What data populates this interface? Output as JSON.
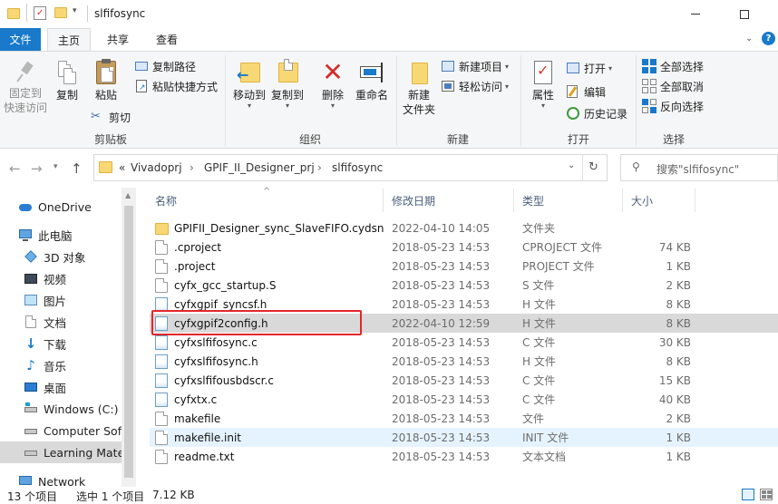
{
  "window": {
    "title": "slfifosync"
  },
  "ribbon_tabs": [
    {
      "label": "文件"
    },
    {
      "label": "主页"
    },
    {
      "label": "共享"
    },
    {
      "label": "查看"
    }
  ],
  "ribbon": {
    "clipboard": {
      "label": "剪贴板",
      "pin": "固定到快速访问",
      "pin_line1": "固定到",
      "pin_line2": "快速访问",
      "copy": "复制",
      "paste": "粘贴",
      "copy_path": "复制路径",
      "paste_shortcut": "粘贴快捷方式",
      "cut": "剪切"
    },
    "organize": {
      "label": "组织",
      "move_to": "移动到",
      "copy_to": "复制到",
      "delete": "删除",
      "rename": "重命名"
    },
    "new": {
      "label": "新建",
      "new_folder_line1": "新建",
      "new_folder_line2": "文件夹",
      "new_item": "新建项目",
      "easy_access": "轻松访问"
    },
    "open": {
      "label": "打开",
      "properties": "属性",
      "open": "打开",
      "edit": "编辑",
      "history": "历史记录"
    },
    "select": {
      "label": "选择",
      "select_all": "全部选择",
      "select_none": "全部取消",
      "invert": "反向选择"
    }
  },
  "address": {
    "prefix": "«",
    "crumbs": [
      "Vivadoprj",
      "GPIF_II_Designer_prj",
      "slfifosync"
    ]
  },
  "search": {
    "placeholder": "搜索\"slfifosync\""
  },
  "sidebar": {
    "items": [
      {
        "label": "OneDrive",
        "icon": "cloud-icon"
      },
      {
        "label": "此电脑",
        "icon": "computer-icon"
      },
      {
        "label": "3D 对象",
        "icon": "cube-icon"
      },
      {
        "label": "视频",
        "icon": "video-icon"
      },
      {
        "label": "图片",
        "icon": "picture-icon"
      },
      {
        "label": "文档",
        "icon": "document-icon"
      },
      {
        "label": "下载",
        "icon": "download-icon"
      },
      {
        "label": "音乐",
        "icon": "music-icon"
      },
      {
        "label": "桌面",
        "icon": "desktop-icon"
      },
      {
        "label": "Windows (C:)",
        "icon": "drive-icon"
      },
      {
        "label": "Computer Soft",
        "icon": "drive-icon"
      },
      {
        "label": "Learning Mate",
        "icon": "drive-icon"
      },
      {
        "label": "Network",
        "icon": "network-icon"
      }
    ]
  },
  "columns": {
    "name": "名称",
    "date": "修改日期",
    "type": "类型",
    "size": "大小"
  },
  "files": [
    {
      "name": "GPIFII_Designer_sync_SlaveFIFO.cydsn",
      "date": "2022-04-10 14:05",
      "type": "文件夹",
      "size": "",
      "kind": "folder"
    },
    {
      "name": ".cproject",
      "date": "2018-05-23 14:53",
      "type": "CPROJECT 文件",
      "size": "74 KB",
      "kind": "doc"
    },
    {
      "name": ".project",
      "date": "2018-05-23 14:53",
      "type": "PROJECT 文件",
      "size": "1 KB",
      "kind": "doc"
    },
    {
      "name": "cyfx_gcc_startup.S",
      "date": "2018-05-23 14:53",
      "type": "S 文件",
      "size": "2 KB",
      "kind": "doc"
    },
    {
      "name": "cyfxgpif_syncsf.h",
      "date": "2018-05-23 14:53",
      "type": "H 文件",
      "size": "8 KB",
      "kind": "h"
    },
    {
      "name": "cyfxgpif2config.h",
      "date": "2022-04-10 12:59",
      "type": "H 文件",
      "size": "8 KB",
      "kind": "h"
    },
    {
      "name": "cyfxslfifosync.c",
      "date": "2018-05-23 14:53",
      "type": "C 文件",
      "size": "30 KB",
      "kind": "c"
    },
    {
      "name": "cyfxslfifosync.h",
      "date": "2018-05-23 14:53",
      "type": "H 文件",
      "size": "8 KB",
      "kind": "h"
    },
    {
      "name": "cyfxslfifousbdscr.c",
      "date": "2018-05-23 14:53",
      "type": "C 文件",
      "size": "15 KB",
      "kind": "c"
    },
    {
      "name": "cyfxtx.c",
      "date": "2018-05-23 14:53",
      "type": "C 文件",
      "size": "40 KB",
      "kind": "c"
    },
    {
      "name": "makefile",
      "date": "2018-05-23 14:53",
      "type": "文件",
      "size": "2 KB",
      "kind": "doc"
    },
    {
      "name": "makefile.init",
      "date": "2018-05-23 14:53",
      "type": "INIT 文件",
      "size": "1 KB",
      "kind": "doc"
    },
    {
      "name": "readme.txt",
      "date": "2018-05-23 14:53",
      "type": "文本文档",
      "size": "1 KB",
      "kind": "doc"
    }
  ],
  "status": {
    "count": "13 个项目",
    "selected": "选中 1 个项目",
    "size": "7.12 KB"
  },
  "colors": {
    "accent": "#1979ca",
    "highlight_box": "#e5262b",
    "selected_row": "#d9d9d9",
    "hover_row": "#e5f3ff"
  }
}
